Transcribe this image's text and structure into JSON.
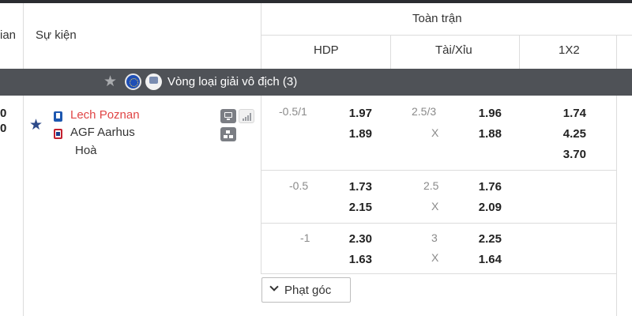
{
  "header": {
    "time_col_partial": "ian",
    "event_col": "Sự kiện",
    "full_match": "Toàn trận",
    "hdp": "HDP",
    "tai_xiu": "Tài/Xỉu",
    "x12": "1X2"
  },
  "league": {
    "name": "Vòng loại giải vô địch (3)",
    "icons": [
      "star-icon",
      "eu-flag-icon",
      "league-logo-icon"
    ]
  },
  "match": {
    "score_home": "0",
    "score_away": "0",
    "home_team": "Lech Poznan",
    "away_team": "AGF Aarhus",
    "draw_label": "Hoà",
    "home_color": "#e04545",
    "markets": [
      {
        "hdp_line": "-0.5/1",
        "hdp_home": "1.97",
        "hdp_away": "1.89",
        "ou_line": "2.5/3",
        "ou_x": "X",
        "ou_over": "1.96",
        "ou_under": "1.88",
        "x12_home": "1.74",
        "x12_away": "4.25",
        "x12_draw": "3.70"
      },
      {
        "hdp_line": "-0.5",
        "hdp_home": "1.73",
        "hdp_away": "2.15",
        "ou_line": "2.5",
        "ou_x": "X",
        "ou_over": "1.76",
        "ou_under": "2.09"
      },
      {
        "hdp_line": "-1",
        "hdp_home": "2.30",
        "hdp_away": "1.63",
        "ou_line": "3",
        "ou_x": "X",
        "ou_over": "2.25",
        "ou_under": "1.64"
      }
    ]
  },
  "corner_button": {
    "label": "Phạt góc"
  },
  "colors": {
    "league_bar": "#4f5257",
    "top_bar": "#2b2d31",
    "favorite_star": "#2d4a8a"
  }
}
